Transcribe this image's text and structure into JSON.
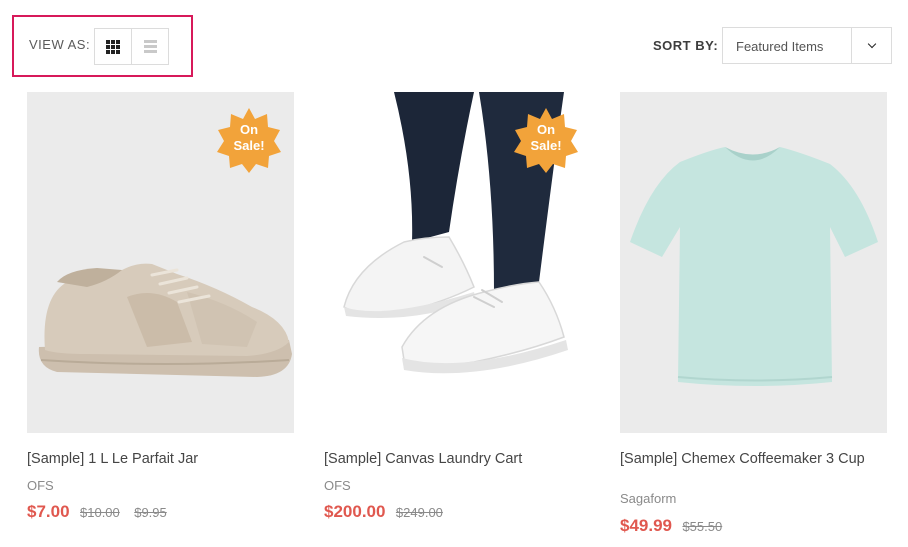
{
  "toolbar": {
    "view_as_label": "VIEW AS:",
    "view_modes": [
      {
        "icon": "grid-icon",
        "active": true
      },
      {
        "icon": "list-icon",
        "active": false
      }
    ],
    "sort_label": "SORT BY:",
    "sort_selected": "Featured Items",
    "highlight_color": "#d7195a"
  },
  "products": [
    {
      "title": "[Sample] 1 L Le Parfait Jar",
      "brand": "OFS",
      "price": "$7.00",
      "old_prices": [
        "$10.00",
        "$9.95"
      ],
      "badge": "On Sale!",
      "image": "beige-sneaker"
    },
    {
      "title": "[Sample] Canvas Laundry Cart",
      "brand": "OFS",
      "price": "$200.00",
      "old_prices": [
        "$249.00"
      ],
      "badge": "On Sale!",
      "image": "white-sneakers-on-feet"
    },
    {
      "title": "[Sample] Chemex Coffeemaker 3 Cup",
      "brand": "Sagaform",
      "price": "$49.99",
      "old_prices": [
        "$55.50"
      ],
      "badge": "",
      "image": "mint-t-shirt"
    }
  ],
  "colors": {
    "sale_price": "#e0584f",
    "badge": "#f2a33a"
  }
}
